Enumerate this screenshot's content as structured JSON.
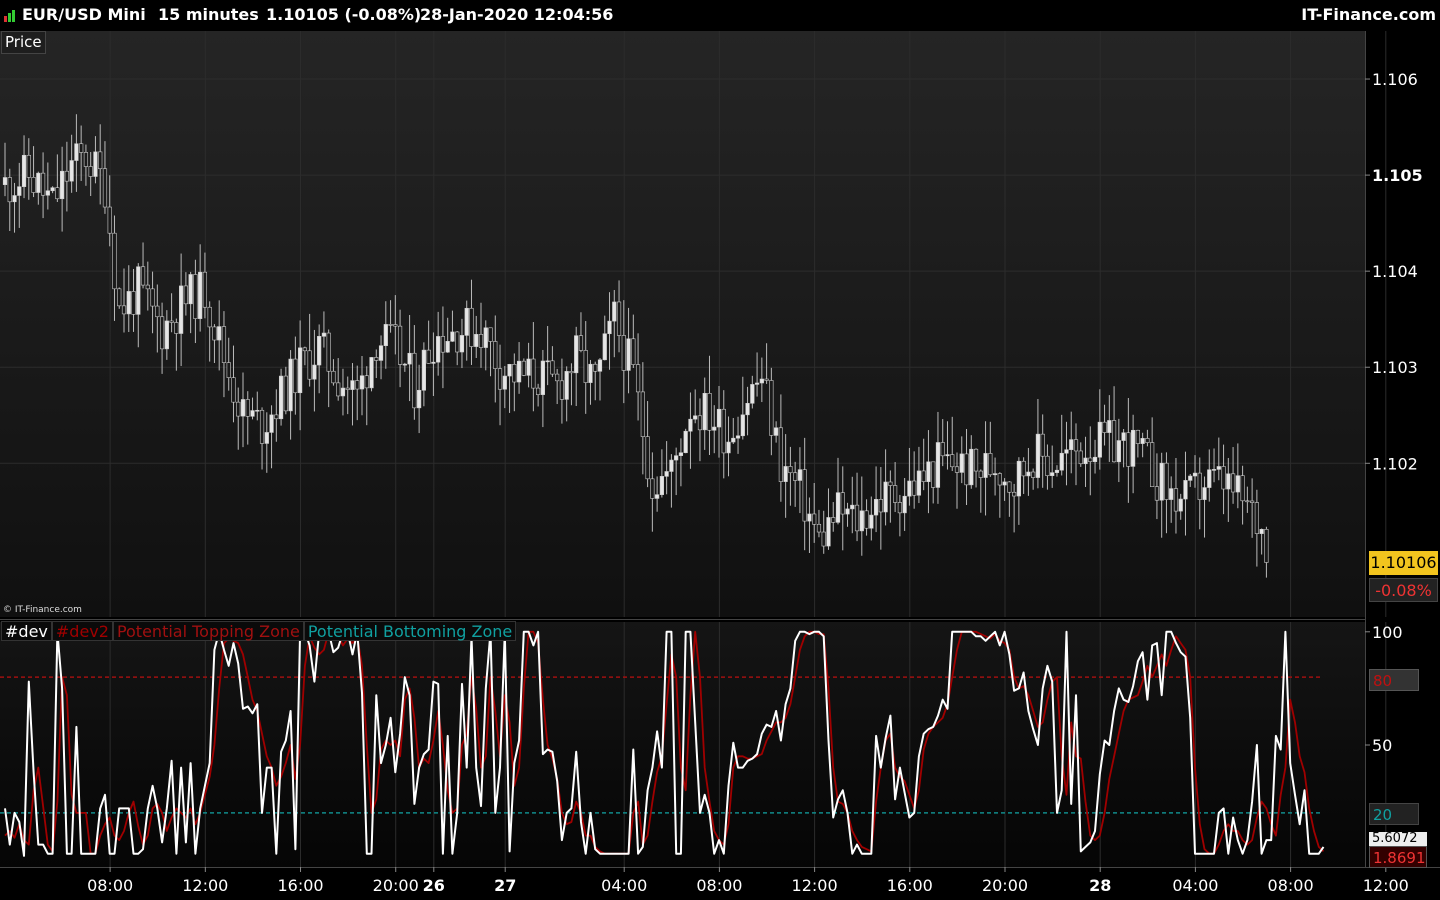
{
  "header": {
    "instrument": "EUR/USD Mini",
    "timeframe": "15 minutes",
    "quote": "1.10105 (-0.08%)",
    "datetime": "28-Jan-2020 12:04:56",
    "brand": "IT-Finance.com"
  },
  "price_panel": {
    "label": "Price",
    "watermark": "© IT-Finance.com",
    "last_price": "1.10106",
    "change": "-0.08%"
  },
  "indicator_panel": {
    "legend": [
      "#dev",
      "#dev2",
      "Potential Topping Zone",
      "Potential Bottoming Zone"
    ],
    "tag_upper": "80",
    "tag_lower": "20",
    "tag_dev": "5.6072",
    "tag_dev2": "1.8691"
  },
  "colors": {
    "background": "#000000",
    "panel_bg_top": "#232323",
    "panel_bg_bottom": "#0e0e0e",
    "grid": "#2c2c2c",
    "candle_up": "#e6e6e6",
    "candle_down": "#1a1a1a",
    "dev_line": "#ffffff",
    "dev2_line": "#a00000",
    "topping_zone": "#a01010",
    "bottoming_zone": "#108a8a",
    "last_price_bg": "#f2c41e",
    "change_text": "#e33333"
  },
  "chart_data": [
    {
      "type": "candlestick",
      "title": "EUR/USD Mini 15 minutes",
      "ylim": [
        1.1004,
        1.1065
      ],
      "y_ticks": [
        "1.106",
        "1.105",
        "1.104",
        "1.103",
        "1.102"
      ],
      "y_tick_values": [
        1.106,
        1.105,
        1.104,
        1.103,
        1.102
      ],
      "x_ticks": [
        "08:00",
        "12:00",
        "16:00",
        "20:00",
        "26",
        "27",
        "04:00",
        "08:00",
        "12:00",
        "16:00",
        "20:00",
        "28",
        "04:00",
        "08:00",
        "12:00"
      ],
      "anchors": [
        [
          0,
          1.1049
        ],
        [
          5,
          1.105
        ],
        [
          10,
          1.1047
        ],
        [
          14,
          1.1051
        ],
        [
          17,
          1.1052
        ],
        [
          21,
          1.1049
        ],
        [
          24,
          1.1036
        ],
        [
          28,
          1.1038
        ],
        [
          33,
          1.1034
        ],
        [
          38,
          1.1037
        ],
        [
          42,
          1.1038
        ],
        [
          46,
          1.1031
        ],
        [
          50,
          1.1025
        ],
        [
          54,
          1.1024
        ],
        [
          58,
          1.1027
        ],
        [
          62,
          1.103
        ],
        [
          66,
          1.1032
        ],
        [
          70,
          1.1029
        ],
        [
          74,
          1.1027
        ],
        [
          78,
          1.1033
        ],
        [
          82,
          1.1032
        ],
        [
          86,
          1.1028
        ],
        [
          90,
          1.1033
        ],
        [
          95,
          1.1034
        ],
        [
          100,
          1.1034
        ],
        [
          104,
          1.103
        ],
        [
          108,
          1.1029
        ],
        [
          112,
          1.1029
        ],
        [
          116,
          1.1028
        ],
        [
          120,
          1.1031
        ],
        [
          124,
          1.1028
        ],
        [
          128,
          1.1035
        ],
        [
          132,
          1.1029
        ],
        [
          136,
          1.1018
        ],
        [
          140,
          1.1019
        ],
        [
          144,
          1.1026
        ],
        [
          148,
          1.1025
        ],
        [
          152,
          1.1023
        ],
        [
          156,
          1.1027
        ],
        [
          159,
          1.1029
        ],
        [
          163,
          1.102
        ],
        [
          167,
          1.1017
        ],
        [
          171,
          1.1012
        ],
        [
          175,
          1.1015
        ],
        [
          179,
          1.1014
        ],
        [
          183,
          1.1016
        ],
        [
          188,
          1.1017
        ],
        [
          192,
          1.1018
        ],
        [
          196,
          1.102
        ],
        [
          200,
          1.102
        ],
        [
          204,
          1.1019
        ],
        [
          208,
          1.102
        ],
        [
          212,
          1.1018
        ],
        [
          216,
          1.1021
        ],
        [
          220,
          1.102
        ],
        [
          224,
          1.1021
        ],
        [
          228,
          1.1022
        ],
        [
          232,
          1.1022
        ],
        [
          236,
          1.1022
        ],
        [
          240,
          1.102
        ],
        [
          244,
          1.1017
        ],
        [
          248,
          1.1016
        ],
        [
          252,
          1.1018
        ],
        [
          256,
          1.1018
        ],
        [
          260,
          1.1016
        ],
        [
          263,
          1.1014
        ],
        [
          265,
          1.1012
        ]
      ]
    },
    {
      "type": "line",
      "ylim": [
        -3,
        103
      ],
      "y_ticks": [
        "100",
        "50"
      ],
      "y_tick_values": [
        100,
        50
      ],
      "x_ticks": [
        "08:00",
        "12:00",
        "16:00",
        "20:00",
        "26",
        "27",
        "04:00",
        "08:00",
        "12:00",
        "16:00",
        "20:00",
        "28",
        "04:00",
        "08:00",
        "12:00"
      ],
      "reference_lines": [
        {
          "name": "Potential Topping Zone",
          "y": 80
        },
        {
          "name": "Potential Bottoming Zone",
          "y": 20
        }
      ],
      "series": [
        {
          "name": "#dev",
          "values": [
            22,
            6,
            20,
            16,
            1,
            78,
            38,
            6,
            6,
            2,
            2,
            100,
            75,
            2,
            2,
            58,
            2,
            2,
            2,
            2,
            22,
            28,
            2,
            2,
            22,
            22,
            22,
            2,
            2,
            4,
            22,
            32,
            22,
            7,
            22,
            43,
            2,
            40,
            7,
            42,
            2,
            22,
            32,
            42,
            92,
            100,
            92,
            85,
            95,
            86,
            66,
            67,
            64,
            68,
            20,
            40,
            40,
            2,
            47,
            52,
            65,
            4,
            100,
            100,
            94,
            78,
            100,
            100,
            100,
            91,
            93,
            100,
            100,
            90,
            100,
            73,
            2,
            2,
            72,
            42,
            50,
            62,
            38,
            55,
            80,
            72,
            24,
            40,
            46,
            48,
            78,
            77,
            2,
            54,
            2,
            20,
            77,
            40,
            98,
            40,
            23,
            75,
            100,
            20,
            40,
            100,
            3,
            42,
            52,
            100,
            100,
            94,
            100,
            46,
            48,
            47,
            34,
            8,
            20,
            22,
            47,
            16,
            2,
            20,
            4,
            2,
            2,
            2,
            2,
            2,
            2,
            2,
            48,
            2,
            5,
            30,
            40,
            56,
            40,
            100,
            100,
            2,
            2,
            100,
            100,
            60,
            20,
            28,
            20,
            2,
            8,
            2,
            32,
            51,
            40,
            40,
            43,
            44,
            46,
            55,
            59,
            58,
            65,
            52,
            68,
            75,
            96,
            100,
            100,
            99,
            100,
            100,
            98,
            52,
            18,
            26,
            30,
            20,
            2,
            6,
            2,
            2,
            2,
            54,
            40,
            53,
            63,
            26,
            40,
            29,
            18,
            20,
            45,
            55,
            57,
            58,
            63,
            70,
            66,
            100,
            100,
            100,
            100,
            100,
            98,
            98,
            96,
            98,
            100,
            94,
            100,
            90,
            74,
            75,
            82,
            65,
            57,
            50,
            75,
            85,
            78,
            20,
            30,
            100,
            24,
            72,
            3,
            5,
            7,
            12,
            37,
            52,
            50,
            65,
            75,
            70,
            69,
            76,
            87,
            91,
            70,
            94,
            95,
            72,
            100,
            100,
            95,
            91,
            89,
            62,
            2,
            2,
            2,
            2,
            2,
            20,
            22,
            2,
            18,
            8,
            2,
            8,
            25,
            50,
            2,
            8,
            8,
            54,
            48,
            100,
            42,
            28,
            15,
            30,
            2,
            2,
            2,
            5
          ],
          "last": "5.6072"
        },
        {
          "name": "#dev2",
          "values": [
            10,
            12,
            9,
            15,
            8,
            6,
            30,
            40,
            23,
            6,
            3,
            25,
            80,
            72,
            28,
            20,
            20,
            20,
            2,
            2,
            10,
            15,
            18,
            10,
            8,
            12,
            20,
            25,
            14,
            6,
            10,
            22,
            24,
            20,
            12,
            18,
            22,
            20,
            18,
            22,
            15,
            20,
            28,
            36,
            50,
            75,
            95,
            97,
            96,
            95,
            90,
            80,
            70,
            65,
            55,
            45,
            40,
            32,
            36,
            42,
            50,
            35,
            50,
            85,
            98,
            93,
            90,
            92,
            100,
            100,
            98,
            94,
            97,
            95,
            98,
            85,
            50,
            20,
            26,
            48,
            52,
            50,
            52,
            45,
            70,
            75,
            62,
            40,
            44,
            42,
            52,
            65,
            50,
            30,
            20,
            22,
            50,
            55,
            80,
            66,
            40,
            45,
            80,
            65,
            45,
            72,
            60,
            32,
            40,
            75,
            100,
            100,
            95,
            70,
            50,
            44,
            35,
            20,
            15,
            16,
            25,
            20,
            10,
            10,
            5,
            3,
            2,
            2,
            2,
            2,
            2,
            2,
            20,
            25,
            6,
            10,
            25,
            38,
            45,
            68,
            90,
            80,
            40,
            30,
            72,
            100,
            80,
            40,
            25,
            12,
            8,
            6,
            15,
            40,
            45,
            45,
            44,
            44,
            45,
            46,
            52,
            56,
            60,
            60,
            62,
            68,
            80,
            92,
            98,
            100,
            100,
            99,
            99,
            75,
            40,
            25,
            24,
            20,
            12,
            8,
            5,
            4,
            3,
            25,
            40,
            52,
            55,
            40,
            36,
            34,
            28,
            22,
            30,
            48,
            55,
            58,
            60,
            62,
            68,
            80,
            92,
            100,
            100,
            100,
            100,
            99,
            98,
            97,
            99,
            96,
            95,
            92,
            80,
            75,
            76,
            72,
            65,
            58,
            60,
            70,
            78,
            80,
            45,
            28,
            60,
            45,
            44,
            25,
            10,
            8,
            10,
            20,
            35,
            45,
            55,
            65,
            70,
            71,
            72,
            78,
            85,
            80,
            85,
            90,
            85,
            92,
            98,
            95,
            92,
            80,
            40,
            15,
            4,
            2,
            2,
            6,
            12,
            15,
            12,
            12,
            8,
            6,
            8,
            18,
            25,
            22,
            15,
            10,
            28,
            40,
            70,
            60,
            45,
            38,
            22,
            12,
            5,
            3
          ],
          "last": "1.8691"
        }
      ]
    }
  ]
}
